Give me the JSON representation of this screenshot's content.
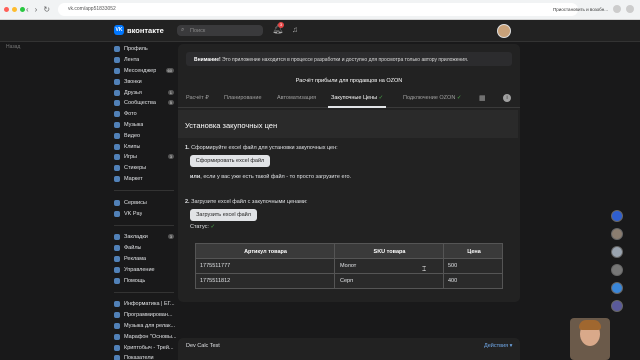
{
  "browser": {
    "url": "vk.com/app51833052",
    "profile_label": "Приостановить и возобн...",
    "colors": {
      "close": "#ff5f57",
      "min": "#febc2e",
      "max": "#28c840"
    }
  },
  "left_label": "Назад",
  "vk": {
    "logo_mark": "VK",
    "logo_text": "вконтакте",
    "search_placeholder": "Поиск",
    "notif_count": "3",
    "accent": "#0077ff"
  },
  "sidebar": {
    "group1": [
      {
        "label": "Профиль",
        "icon": "user-icon"
      },
      {
        "label": "Лента",
        "icon": "feed-icon"
      },
      {
        "label": "Мессенджер",
        "icon": "message-icon",
        "badge": "60"
      },
      {
        "label": "Звонки",
        "icon": "phone-icon"
      },
      {
        "label": "Друзья",
        "icon": "friends-icon",
        "badge": "1"
      },
      {
        "label": "Сообщества",
        "icon": "groups-icon",
        "badge": "5"
      },
      {
        "label": "Фото",
        "icon": "photo-icon"
      },
      {
        "label": "Музыка",
        "icon": "music-icon"
      },
      {
        "label": "Видео",
        "icon": "video-icon"
      },
      {
        "label": "Клипы",
        "icon": "clips-icon"
      },
      {
        "label": "Игры",
        "icon": "games-icon",
        "badge": "3"
      },
      {
        "label": "Стикеры",
        "icon": "stickers-icon"
      },
      {
        "label": "Маркет",
        "icon": "market-icon"
      }
    ],
    "group2": [
      {
        "label": "Сервисы",
        "icon": "services-icon"
      },
      {
        "label": "VK Pay",
        "icon": "vkpay-icon"
      }
    ],
    "group3": [
      {
        "label": "Закладки",
        "icon": "bookmark-icon",
        "badge": "3"
      },
      {
        "label": "Файлы",
        "icon": "files-icon"
      },
      {
        "label": "Реклама",
        "icon": "ads-icon"
      },
      {
        "label": "Управление",
        "icon": "manage-icon"
      },
      {
        "label": "Помощь",
        "icon": "help-icon"
      }
    ],
    "group4": [
      {
        "label": "Информатика | ЕГ...",
        "icon": "app-icon"
      },
      {
        "label": "Программирован...",
        "icon": "app-icon"
      },
      {
        "label": "Музыка для релак...",
        "icon": "app-icon"
      },
      {
        "label": "Марафон \"Основы...",
        "icon": "app-icon"
      },
      {
        "label": "Криптобыч - Трей...",
        "icon": "app-icon"
      },
      {
        "label": "Показатели",
        "icon": "app-icon"
      }
    ]
  },
  "app": {
    "warning_bold": "Внимание!",
    "warning_text": " Это приложение находится в процессе разработки и доступно для просмотра только автору приложения.",
    "title": "Расчёт прибыли для продавцов на OZON",
    "tabs": [
      {
        "label": "Расчёт ₽"
      },
      {
        "label": "Планирование"
      },
      {
        "label": "Автоматизация"
      },
      {
        "label": "Закупочные Цены",
        "check": "✓"
      },
      {
        "label": "Подключение OZON",
        "check": "✓"
      }
    ],
    "section_title": "Установка закупочных цен",
    "step1_num": "1.",
    "step1_text": " Сформируйте excel файл для установки закупочных цен:",
    "btn_generate": "Сформировать excel файл",
    "or_bold": "или",
    "or_text": ", если у вас уже есть такой файл - то просто загрузите его.",
    "step2_num": "2.",
    "step2_text": " Загрузите excel файл с закупочными ценами:",
    "btn_upload": "Загрузить excel файл",
    "status_label": "Статус:",
    "status_check": "✓",
    "table": {
      "headers": [
        "Артикул товара",
        "SKU товара",
        "Цена"
      ],
      "rows": [
        [
          "1775511777",
          "Молот",
          "500"
        ],
        [
          "1775511812",
          "Серп",
          "400"
        ]
      ]
    },
    "footer_name": "Dev Calc Test",
    "footer_action": "Действия ▾"
  }
}
